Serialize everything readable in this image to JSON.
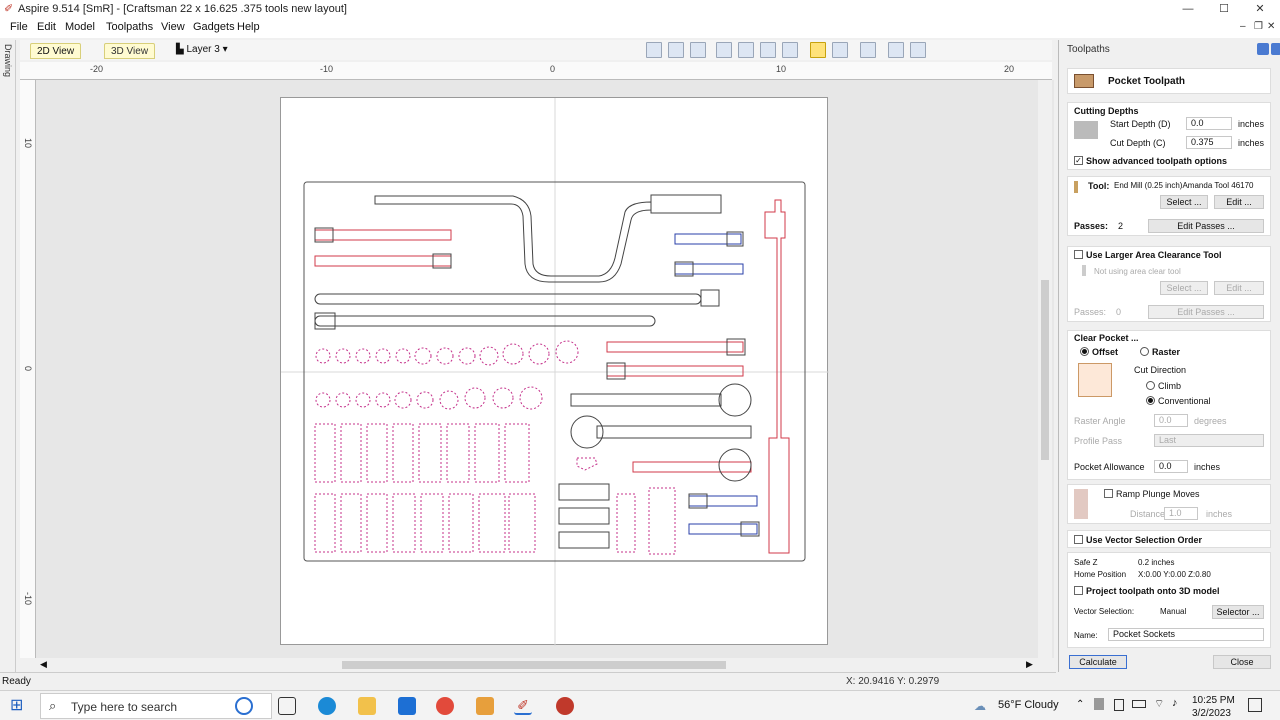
{
  "window": {
    "title": "Aspire 9.514 [SmR] - [Craftsman 22 x 16.625 .375 tools new layout]",
    "minimize": "—",
    "maximize": "☐",
    "close": "✕"
  },
  "menu": [
    "File",
    "Edit",
    "Model",
    "Toolpaths",
    "View",
    "Gadgets",
    "Help"
  ],
  "toolbar": {
    "tab_2d": "2D View",
    "tab_3d": "3D View",
    "layer": "Layer 3 ▾"
  },
  "left_strip": {
    "label": "Drawing"
  },
  "ruler": {
    "top": [
      "-20",
      "-10",
      "0",
      "10",
      "20"
    ],
    "left": [
      "10",
      "0",
      "-10"
    ]
  },
  "status": {
    "ready": "Ready",
    "coords": "X: 20.9416 Y: 0.2979"
  },
  "panel": {
    "title": "Toolpaths",
    "header": "Pocket Toolpath",
    "cutting_depths": {
      "heading": "Cutting Depths",
      "start_label": "Start Depth (D)",
      "start_value": "0.0",
      "start_unit": "inches",
      "cut_label": "Cut Depth (C)",
      "cut_value": "0.375",
      "cut_unit": "inches",
      "advanced": "Show advanced toolpath options"
    },
    "tool": {
      "label": "Tool:",
      "name": "End Mill (0.25 inch)Amanda Tool 46170",
      "select": "Select ...",
      "edit": "Edit ...",
      "passes_label": "Passes:",
      "passes_value": "2",
      "edit_passes": "Edit Passes ..."
    },
    "clearance": {
      "heading": "Use Larger Area Clearance Tool",
      "not_using": "Not using area clear tool",
      "select": "Select ...",
      "edit": "Edit ...",
      "passes_label": "Passes:",
      "passes_value": "0",
      "edit_passes": "Edit Passes ..."
    },
    "clear_pocket": {
      "heading": "Clear Pocket ...",
      "offset": "Offset",
      "raster": "Raster",
      "cut_direction": "Cut Direction",
      "climb": "Climb",
      "conventional": "Conventional",
      "raster_angle_label": "Raster Angle",
      "raster_angle_value": "0.0",
      "raster_angle_unit": "degrees",
      "profile_pass_label": "Profile Pass",
      "profile_pass_value": "Last",
      "allowance_label": "Pocket Allowance",
      "allowance_value": "0.0",
      "allowance_unit": "inches"
    },
    "ramp": {
      "label": "Ramp Plunge Moves",
      "distance_label": "Distance",
      "distance_value": "1.0",
      "distance_unit": "inches"
    },
    "vector_order": "Use Vector Selection Order",
    "safe_z_label": "Safe Z",
    "safe_z_value": "0.2 inches",
    "home_label": "Home Position",
    "home_value": "X:0.00 Y:0.00 Z:0.80",
    "project": "Project toolpath onto 3D model",
    "vector_selection_label": "Vector Selection:",
    "vector_selection_value": "Manual",
    "selector": "Selector ...",
    "name_label": "Name:",
    "name_value": "Pocket Sockets",
    "calculate": "Calculate",
    "close": "Close"
  },
  "taskbar": {
    "search_placeholder": "Type here to search",
    "weather": "56°F  Cloudy",
    "time": "10:25 PM",
    "date": "3/2/2023"
  },
  "colors": {
    "selected_vector": "#d23a4a",
    "dashed_vector": "#c4308a",
    "blue_vector": "#2a3fa8",
    "active_tab": "#fffbd1"
  }
}
